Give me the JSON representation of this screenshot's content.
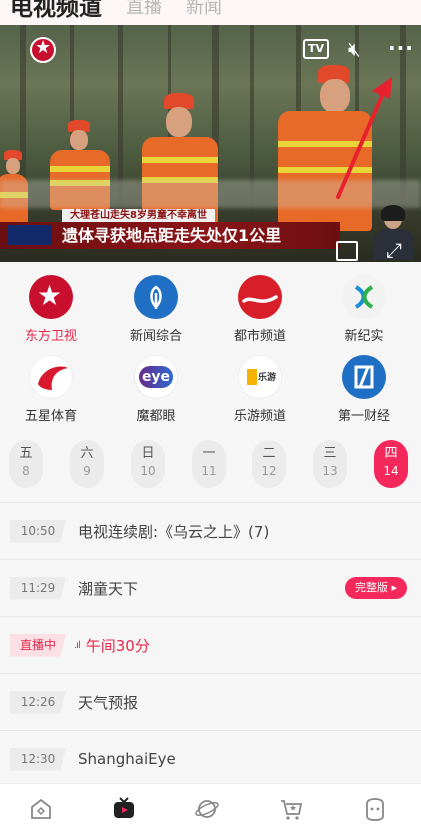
{
  "header": {
    "tabs": [
      {
        "label": "电视频道"
      },
      {
        "label": "直播"
      },
      {
        "label": "新闻"
      }
    ]
  },
  "video": {
    "tv_label": "TV",
    "ticker_top": "大理苍山走失8岁男童不幸离世",
    "ticker_main": "遗体寻获地点距走失处仅1公里"
  },
  "channels": [
    {
      "name": "东方卫视",
      "icon": "dragon-tv-logo",
      "active": true
    },
    {
      "name": "新闻综合",
      "icon": "news-logo"
    },
    {
      "name": "都市频道",
      "icon": "city-logo"
    },
    {
      "name": "新纪实",
      "icon": "documentary-logo"
    },
    {
      "name": "五星体育",
      "icon": "sports-logo"
    },
    {
      "name": "魔都眼",
      "icon": "eye-logo",
      "logo_text": "eye"
    },
    {
      "name": "乐游频道",
      "icon": "travel-logo",
      "logo_text": "乐游"
    },
    {
      "name": "第一财经",
      "icon": "finance-logo"
    }
  ],
  "dates": [
    {
      "weekday": "五",
      "day": "8"
    },
    {
      "weekday": "六",
      "day": "9"
    },
    {
      "weekday": "日",
      "day": "10"
    },
    {
      "weekday": "一",
      "day": "11"
    },
    {
      "weekday": "二",
      "day": "12"
    },
    {
      "weekday": "三",
      "day": "13"
    },
    {
      "weekday": "四",
      "day": "14",
      "selected": true
    }
  ],
  "schedule": [
    {
      "time": "10:50",
      "title": "电视连续剧:《乌云之上》(7)"
    },
    {
      "time": "11:29",
      "title": "潮童天下",
      "badge": "完整版 ▸"
    },
    {
      "time": "直播中",
      "title": "午间30分",
      "live": true,
      "live_bars": ".ıl"
    },
    {
      "time": "12:26",
      "title": "天气预报"
    },
    {
      "time": "12:30",
      "title": "ShanghaiEye"
    }
  ],
  "bottom_nav": [
    {
      "icon": "home-icon"
    },
    {
      "icon": "tv-icon",
      "active": true
    },
    {
      "icon": "planet-icon"
    },
    {
      "icon": "cart-star-icon"
    },
    {
      "icon": "face-icon"
    }
  ],
  "colors": {
    "accent": "#f4285a",
    "accent_text": "#e8284a",
    "video_ticker": "#8b1418"
  }
}
